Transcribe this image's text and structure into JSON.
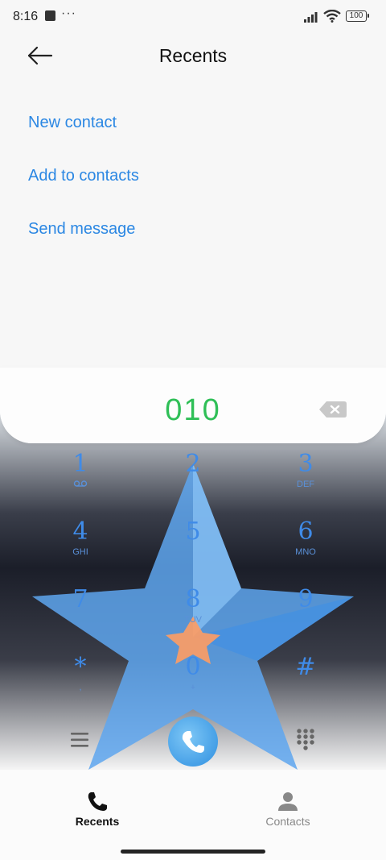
{
  "status": {
    "time": "8:16",
    "dots": "···",
    "battery": "100"
  },
  "header": {
    "title": "Recents"
  },
  "actions": [
    {
      "label": "New contact"
    },
    {
      "label": "Add to contacts"
    },
    {
      "label": "Send message"
    }
  ],
  "dialer": {
    "number": "010"
  },
  "keypad": [
    {
      "digit": "1",
      "letters": ""
    },
    {
      "digit": "2",
      "letters": ""
    },
    {
      "digit": "3",
      "letters": "DEF"
    },
    {
      "digit": "4",
      "letters": "GHI"
    },
    {
      "digit": "5",
      "letters": ""
    },
    {
      "digit": "6",
      "letters": "MNO"
    },
    {
      "digit": "7",
      "letters": ""
    },
    {
      "digit": "8",
      "letters": "TUV"
    },
    {
      "digit": "9",
      "letters": ""
    },
    {
      "digit": "*",
      "letters": ","
    },
    {
      "digit": "0",
      "letters": "+"
    },
    {
      "digit": "#",
      "letters": ""
    }
  ],
  "nav": {
    "recents": "Recents",
    "contacts": "Contacts"
  },
  "colors": {
    "accent": "#2b87e3",
    "number": "#2fbf57",
    "key": "#3f8be8"
  },
  "icons": {
    "back": "arrow-left-icon",
    "backspace": "backspace-icon",
    "menu": "menu-icon",
    "call": "phone-icon",
    "keypad": "dialpad-icon",
    "voicemail": "voicemail-icon"
  }
}
